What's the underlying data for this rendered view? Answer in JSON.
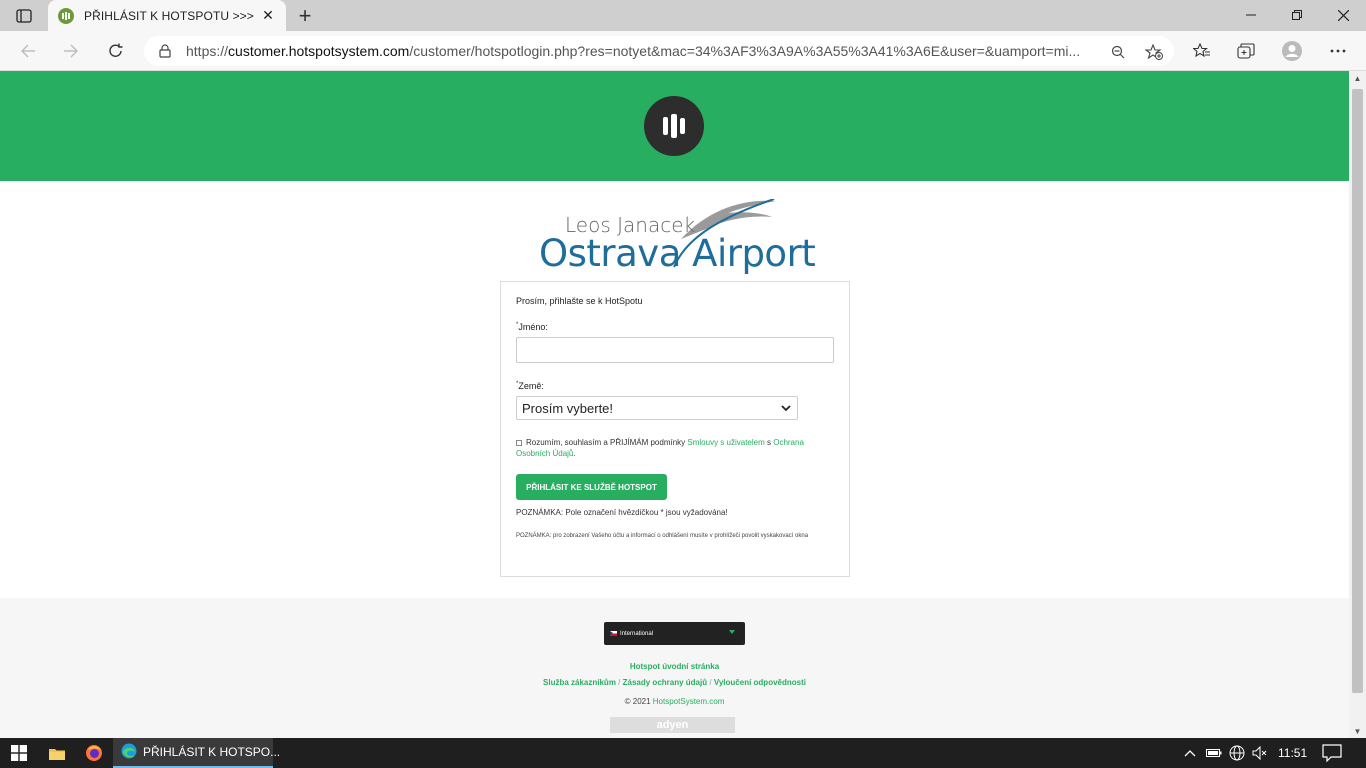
{
  "browser": {
    "tab_title": "PŘIHLÁSIT K HOTSPOTU >>>",
    "url_prefix": "https://",
    "url_host": "customer.hotspotsystem.com",
    "url_path": "/customer/hotspotlogin.php?res=notyet&mac=34%3AF3%3A9A%3A55%3A41%3A6E&user=&uamport=mi..."
  },
  "logo": {
    "small_text": "Leos Janacek",
    "big_text_left": "Ostrava",
    "big_text_right": "Airport"
  },
  "form": {
    "title": "Prosím, přihlašte se k HotSpotu",
    "name_label": "Jméno:",
    "name_value": "",
    "country_label": "Země:",
    "country_selected": "Prosím vyberte!",
    "required_mark": "*",
    "terms_prefix": "Rozumím, souhlasím a PŘIJÍMÁM podmínky",
    "terms_link1": "Smlouvy s uživatelem",
    "terms_mid": "s",
    "terms_link2": "Ochrana Osobních Údajů",
    "terms_suffix": ".",
    "login_button": "PŘIHLÁSIT KE SLUŽBĚ HOTSPOT",
    "note1": "POZNÁMKA: Pole označení hvězdičkou * jsou vyžadována!",
    "note2": "POZNÁMKA: pro zobrazení Vašeho účtu a informací o odhlášení musíte v prohlížeči povolit vyskakovací okna"
  },
  "footer": {
    "language": "International",
    "home_link": "Hotspot úvodní stránka",
    "service_link": "Služba zákazníkům",
    "privacy_link": "Zásady ochrany údajů",
    "disclaimer_link": "Vyloučení odpovědnosti",
    "sep": "/",
    "copyright": "© 2021",
    "copyright_link": "HotspotSystem.com",
    "payment_badge": "adyen"
  },
  "taskbar": {
    "edge_label": "PŘIHLÁSIT K HOTSPO...",
    "time": "11:51"
  },
  "colors": {
    "brand_green": "#28ae60",
    "logo_blue": "#1f6d9b"
  }
}
